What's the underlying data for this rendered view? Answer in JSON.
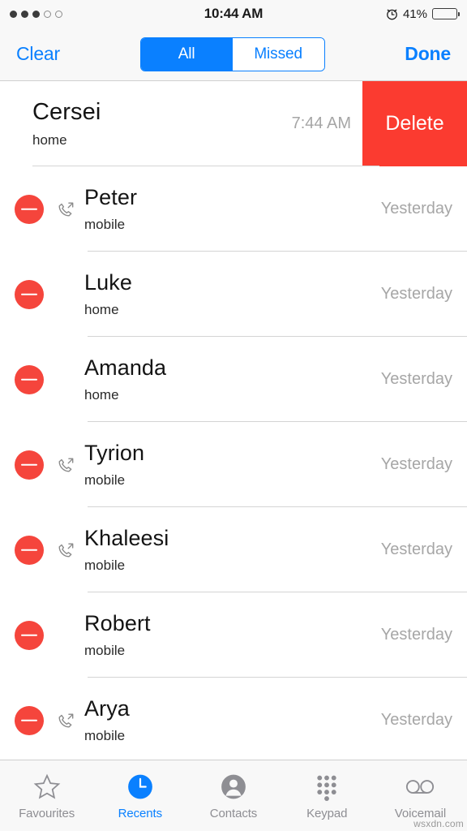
{
  "status_bar": {
    "signal_dots_filled": 3,
    "signal_dots_total": 5,
    "time": "10:44 AM",
    "alarm_icon": "alarm-clock-icon",
    "battery_percent": "41%",
    "battery_level": 41,
    "battery_color": "#f8c52c"
  },
  "nav_bar": {
    "clear_label": "Clear",
    "done_label": "Done",
    "segments": [
      {
        "label": "All",
        "selected": true
      },
      {
        "label": "Missed",
        "selected": false
      }
    ],
    "accent_color": "#0a80ff"
  },
  "list": {
    "swiped_row": {
      "name": "Cersei",
      "subtitle": "home",
      "time": "7:44 AM",
      "delete_label": "Delete",
      "delete_color": "#fb3b30"
    },
    "rows": [
      {
        "name": "Peter",
        "subtitle": "mobile",
        "time": "Yesterday",
        "outgoing": true
      },
      {
        "name": "Luke",
        "subtitle": "home",
        "time": "Yesterday",
        "outgoing": false
      },
      {
        "name": "Amanda",
        "subtitle": "home",
        "time": "Yesterday",
        "outgoing": false
      },
      {
        "name": "Tyrion",
        "subtitle": "mobile",
        "time": "Yesterday",
        "outgoing": true
      },
      {
        "name": "Khaleesi",
        "subtitle": "mobile",
        "time": "Yesterday",
        "outgoing": true
      },
      {
        "name": "Robert",
        "subtitle": "mobile",
        "time": "Yesterday",
        "outgoing": false
      },
      {
        "name": "Arya",
        "subtitle": "mobile",
        "time": "Yesterday",
        "outgoing": true
      }
    ],
    "delete_badge_icon": "minus-circle-icon",
    "delete_badge_color": "#f5453c"
  },
  "tab_bar": {
    "tabs": [
      {
        "label": "Favourites",
        "icon": "star-icon",
        "active": false
      },
      {
        "label": "Recents",
        "icon": "clock-icon",
        "active": true
      },
      {
        "label": "Contacts",
        "icon": "person-icon",
        "active": false
      },
      {
        "label": "Keypad",
        "icon": "keypad-icon",
        "active": false
      },
      {
        "label": "Voicemail",
        "icon": "voicemail-icon",
        "active": false
      }
    ],
    "active_color": "#0a80ff",
    "inactive_color": "#8e8e93"
  },
  "watermark": "wsxdn.com"
}
